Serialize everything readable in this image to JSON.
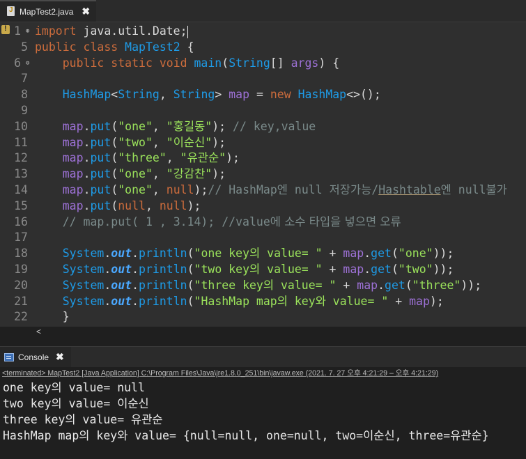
{
  "editor_tab": {
    "title": "MapTest2.java",
    "close": "✖"
  },
  "code_lines": [
    {
      "n": "1",
      "html": "<span class=\"kw\">import</span> java.util.Date;"
    },
    {
      "n": "5",
      "html": "<span class=\"kw\">public class</span> <span class=\"cls\">MapTest2</span> {"
    },
    {
      "n": "6",
      "html": "    <span class=\"kw\">public static void</span> <span class=\"cls\">main</span>(<span class=\"cls\">String</span>[] <span class=\"var\">args</span>) {"
    },
    {
      "n": "7",
      "html": ""
    },
    {
      "n": "8",
      "html": "    <span class=\"cls\">HashMap</span>&lt;<span class=\"cls\">String</span>, <span class=\"cls\">String</span>&gt; <span class=\"var\">map</span> = <span class=\"kw\">new</span> <span class=\"cls\">HashMap</span>&lt;&gt;();"
    },
    {
      "n": "9",
      "html": ""
    },
    {
      "n": "10",
      "html": "    <span class=\"var\">map</span>.<span class=\"cls\">put</span>(<span class=\"str\">\"one\"</span>, <span class=\"str\">\"<span class=\"ko\">홍길동</span>\"</span>); <span class=\"cm\">// key,value</span>"
    },
    {
      "n": "11",
      "html": "    <span class=\"var\">map</span>.<span class=\"cls\">put</span>(<span class=\"str\">\"two\"</span>, <span class=\"str\">\"<span class=\"ko\">이순신</span>\"</span>);"
    },
    {
      "n": "12",
      "html": "    <span class=\"var\">map</span>.<span class=\"cls\">put</span>(<span class=\"str\">\"three\"</span>, <span class=\"str\">\"<span class=\"ko\">유관순</span>\"</span>);"
    },
    {
      "n": "13",
      "html": "    <span class=\"var\">map</span>.<span class=\"cls\">put</span>(<span class=\"str\">\"one\"</span>, <span class=\"str\">\"<span class=\"ko\">강감찬</span>\"</span>);"
    },
    {
      "n": "14",
      "html": "    <span class=\"var\">map</span>.<span class=\"cls\">put</span>(<span class=\"str\">\"one\"</span>, <span class=\"kw\">null</span>);<span class=\"cm\">// HashMap<span class=\"ko\">엔</span> null <span class=\"ko\">저장가능</span>/<span class=\"underline\">Hashtable</span><span class=\"ko\">엔</span> null<span class=\"ko\">불가</span></span>"
    },
    {
      "n": "15",
      "html": "    <span class=\"var\">map</span>.<span class=\"cls\">put</span>(<span class=\"kw\">null</span>, <span class=\"kw\">null</span>);"
    },
    {
      "n": "16",
      "html": "    <span class=\"cm\">// map.put( 1 , 3.14); //value<span class=\"ko\">에 소수 타입을 넣으면 오류</span></span>"
    },
    {
      "n": "17",
      "html": ""
    },
    {
      "n": "18",
      "html": "    <span class=\"cls\">System</span>.<span class=\"out\">out</span>.<span class=\"cls\">println</span>(<span class=\"str\">\"one key<span class=\"ko\">의</span> value= \"</span> + <span class=\"var\">map</span>.<span class=\"cls\">get</span>(<span class=\"str\">\"one\"</span>));"
    },
    {
      "n": "19",
      "html": "    <span class=\"cls\">System</span>.<span class=\"out\">out</span>.<span class=\"cls\">println</span>(<span class=\"str\">\"two key<span class=\"ko\">의</span> value= \"</span> + <span class=\"var\">map</span>.<span class=\"cls\">get</span>(<span class=\"str\">\"two\"</span>));"
    },
    {
      "n": "20",
      "html": "    <span class=\"cls\">System</span>.<span class=\"out\">out</span>.<span class=\"cls\">println</span>(<span class=\"str\">\"three key<span class=\"ko\">의</span> value= \"</span> + <span class=\"var\">map</span>.<span class=\"cls\">get</span>(<span class=\"str\">\"three\"</span>));"
    },
    {
      "n": "21",
      "html": "    <span class=\"cls\">System</span>.<span class=\"out\">out</span>.<span class=\"cls\">println</span>(<span class=\"str\">\"HashMap map<span class=\"ko\">의</span> key<span class=\"ko\">와</span> value= \"</span> + <span class=\"var\">map</span>);"
    },
    {
      "n": "22",
      "html": "    }"
    }
  ],
  "console_tab": {
    "title": "Console",
    "close": "✖"
  },
  "console_status": "<terminated> MapTest2 [Java Application] C:\\Program Files\\Java\\jre1.8.0_251\\bin\\javaw.exe  (2021. 7. 27 오후 4:21:29 – 오후 4:21:29)",
  "console_output": [
    "one key의 value= null",
    "two key의 value= 이순신",
    "three key의 value= 유관순",
    "HashMap map의 key와 value= {null=null, one=null, two=이순신, three=유관순}"
  ],
  "scroll_left": "<"
}
